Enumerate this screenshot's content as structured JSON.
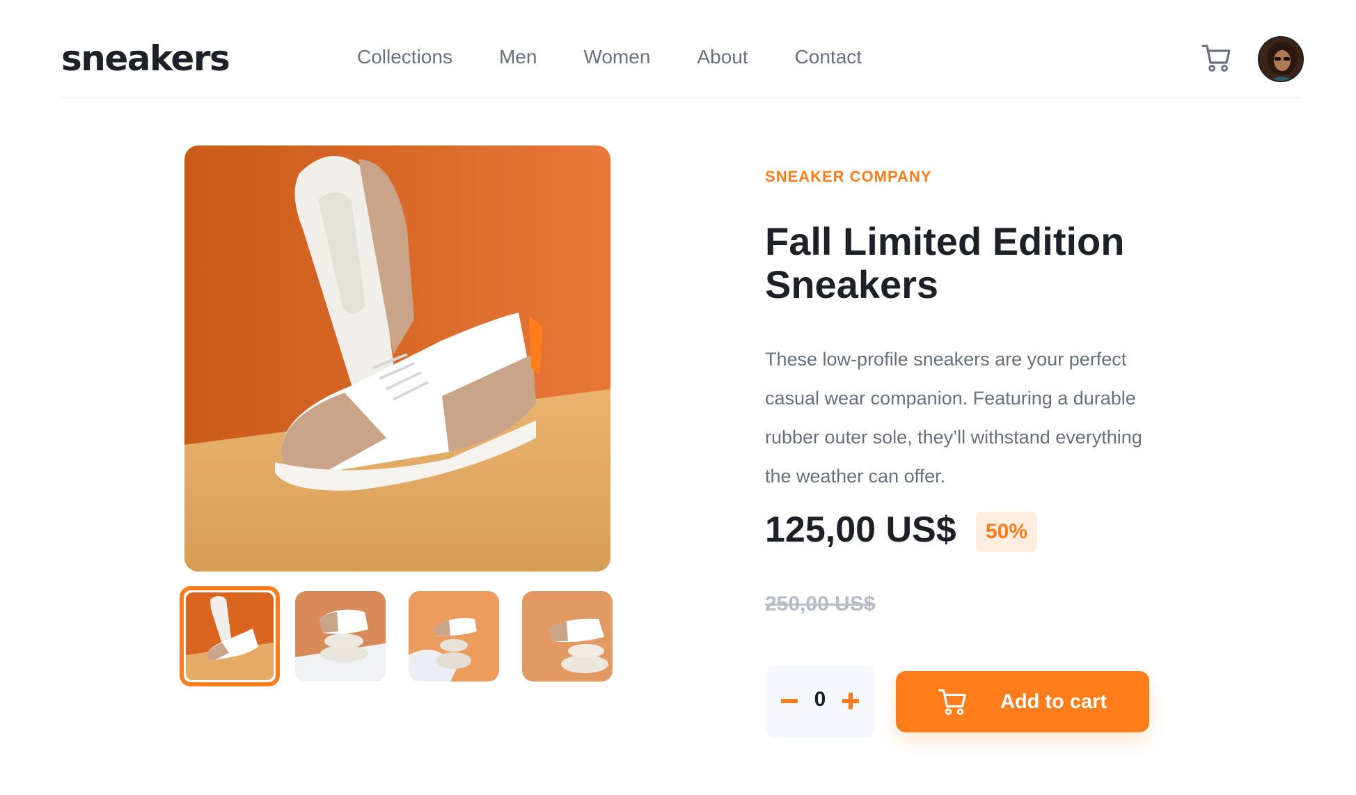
{
  "header": {
    "logo": "sneakers",
    "nav": [
      "Collections",
      "Men",
      "Women",
      "About",
      "Contact"
    ],
    "cart_icon": "cart-icon",
    "avatar_icon": "user-avatar"
  },
  "gallery": {
    "main_image": "product-image-1",
    "thumbnails": [
      "product-thumbnail-1",
      "product-thumbnail-2",
      "product-thumbnail-3",
      "product-thumbnail-4"
    ],
    "active_index": 0
  },
  "product": {
    "company": "SNEAKER COMPANY",
    "title": "Fall Limited Edition Sneakers",
    "description": "These low-profile sneakers are your perfect casual wear companion. Featuring a durable rubber outer sole, they’ll withstand everything the weather can offer.",
    "price": "125,00 US$",
    "discount": "50%",
    "old_price": "250,00 US$"
  },
  "cart": {
    "quantity": "0",
    "add_label": "Add to cart"
  },
  "colors": {
    "accent": "#ff7e1b",
    "accent_pale": "#ffede0",
    "text_dark": "#1d2026",
    "text_gray": "#69707d"
  }
}
